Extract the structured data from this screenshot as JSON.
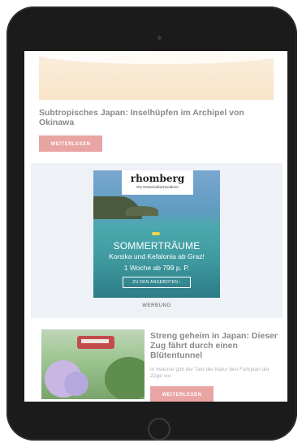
{
  "article1": {
    "title": "Subtropisches Japan: Inselhüpfen im Archipel von Okinawa",
    "button_label": "WEITERLESEN"
  },
  "ad": {
    "brand": "rhomberg",
    "brand_tagline": "Die Reisemaßschneiderei",
    "headline": "SOMMERTRÄUME",
    "line1": "Korsika und Kefalonia ab Graz!",
    "line2": "1 Woche ab 799 p. P.",
    "cta": "ZU DEN ANGEBOTEN ›",
    "label": "WERBUNG"
  },
  "article2": {
    "title": "Streng geheim in Japan: Dieser Zug fährt durch einen Blütentunnel",
    "teaser": "In Hakone gibt der Takt der Natur den Fahrplan der Züge vor.",
    "button_label": "WEITERLESEN"
  },
  "colors": {
    "device": "#1b1b1b",
    "button": "#e9a4a4",
    "ad_background": "#eef1f6",
    "title_text": "#8a8a8a"
  }
}
